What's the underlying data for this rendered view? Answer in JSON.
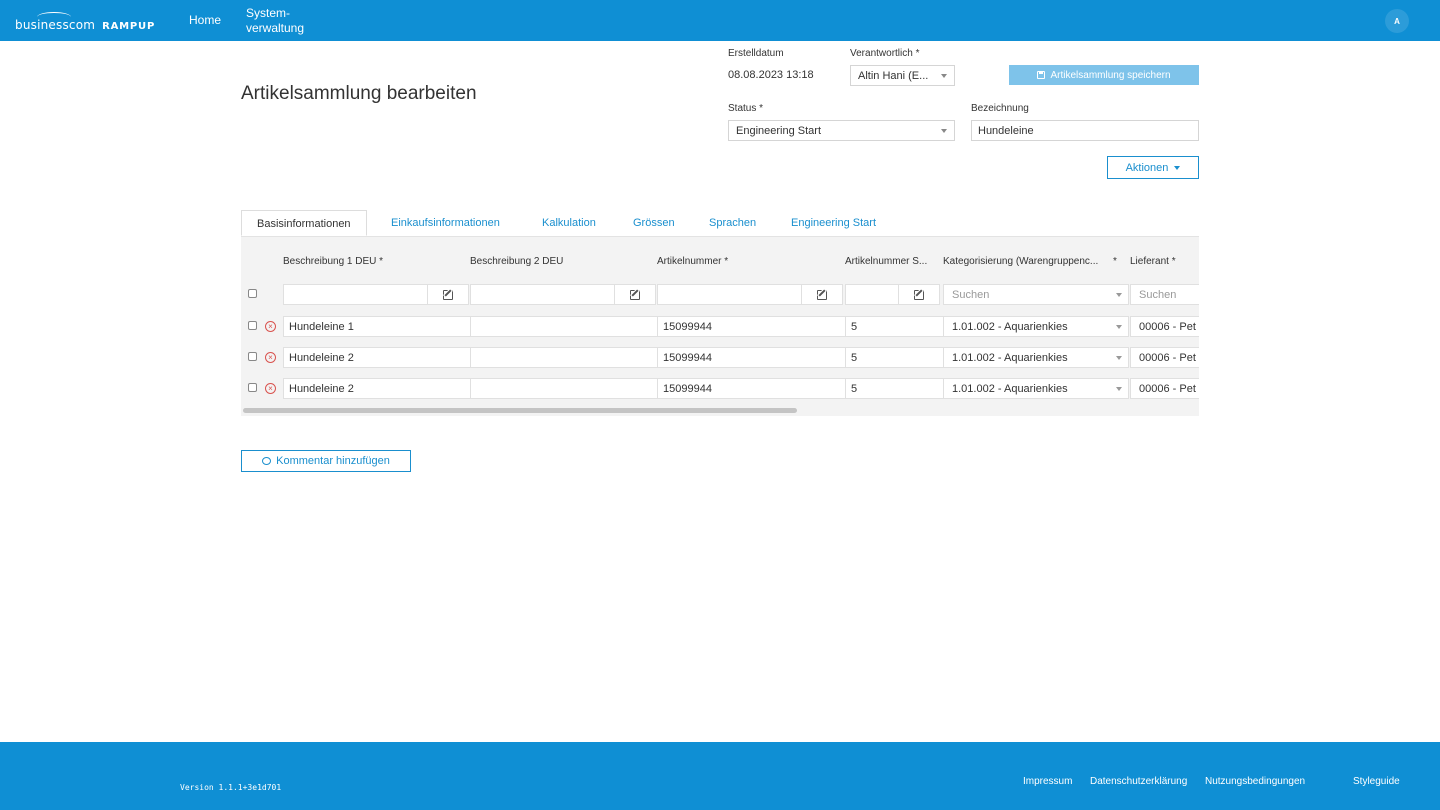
{
  "nav": {
    "logo_business": "businesscom",
    "logo_product": "RAMPUP",
    "home": "Home",
    "system": "System-verwaltung",
    "avatar_initial": "A"
  },
  "header": {
    "title": "Artikelsammlung bearbeiten",
    "erstelldatum_label": "Erstelldatum",
    "erstelldatum_value": "08.08.2023 13:18",
    "verantwortlich_label": "Verantwortlich *",
    "verantwortlich_value": "Altin Hani (E...",
    "save_label": "Artikelsammlung speichern",
    "status_label": "Status *",
    "status_value": "Engineering Start",
    "bezeichnung_label": "Bezeichnung",
    "bezeichnung_value": "Hundeleine",
    "aktionen_label": "Aktionen"
  },
  "tabs": [
    {
      "label": "Basisinformationen",
      "active": true
    },
    {
      "label": "Einkaufsinformationen",
      "active": false
    },
    {
      "label": "Kalkulation",
      "active": false
    },
    {
      "label": "Grössen",
      "active": false
    },
    {
      "label": "Sprachen",
      "active": false
    },
    {
      "label": "Engineering Start",
      "active": false
    }
  ],
  "grid": {
    "columns": [
      "Beschreibung 1 DEU *",
      "Beschreibung 2 DEU",
      "Artikelnummer *",
      "Artikelnummer S...",
      "Kategorisierung (Warengruppenc...",
      "*",
      "Lieferant *"
    ],
    "filter_placeholder_kategorie": "Suchen",
    "filter_placeholder_lieferant": "Suchen",
    "rows": [
      {
        "beschreibung1": "Hundeleine 1",
        "beschreibung2": "",
        "artikelnummer": "15099944",
        "artikelnummer_s": "5",
        "kategorie": "1.01.002 - Aquarienkies",
        "lieferant": "00006 - Pet"
      },
      {
        "beschreibung1": "Hundeleine 2",
        "beschreibung2": "",
        "artikelnummer": "15099944",
        "artikelnummer_s": "5",
        "kategorie": "1.01.002 - Aquarienkies",
        "lieferant": "00006 - Pet"
      },
      {
        "beschreibung1": "Hundeleine 2",
        "beschreibung2": "",
        "artikelnummer": "15099944",
        "artikelnummer_s": "5",
        "kategorie": "1.01.002 - Aquarienkies",
        "lieferant": "00006 - Pet"
      }
    ]
  },
  "comment_label": "Kommentar hinzufügen",
  "footer": {
    "version": "Version 1.1.1+3e1d701",
    "links": [
      "Impressum",
      "Datenschutzerklärung",
      "Nutzungsbedingungen",
      "Styleguide"
    ]
  },
  "colors": {
    "brand": "#0f8fd4",
    "link": "#1a8fce",
    "save_button": "#7ec3ea",
    "remove_icon": "#d9534f"
  }
}
